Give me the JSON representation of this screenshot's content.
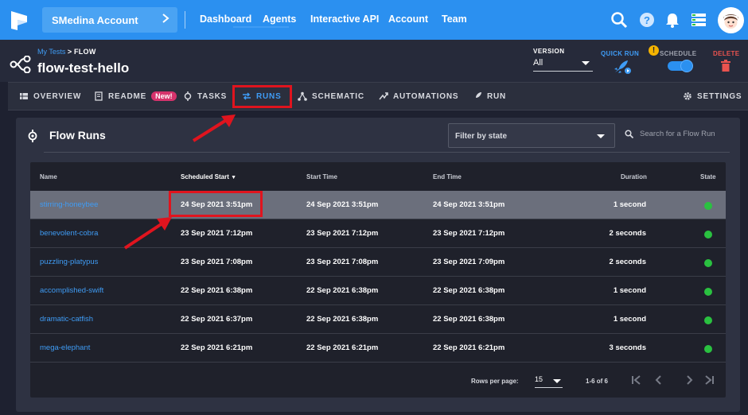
{
  "topbar": {
    "account_label": "SMedina Account",
    "nav": [
      "Dashboard",
      "Agents",
      "Interactive API",
      "Account",
      "Team"
    ]
  },
  "header": {
    "breadcrumb_link": "My Tests",
    "breadcrumb_sep": ">",
    "breadcrumb_current": "FLOW",
    "flow_title": "flow-test-hello",
    "version_label": "VERSION",
    "version_value": "All",
    "quick_run_label": "QUICK RUN",
    "schedule_label": "SCHEDULE",
    "delete_label": "DELETE",
    "warning_glyph": "!"
  },
  "tabs": [
    {
      "label": "OVERVIEW",
      "icon": "grid-icon"
    },
    {
      "label": "README",
      "icon": "document-icon",
      "badge": "New!"
    },
    {
      "label": "TASKS",
      "icon": "task-icon"
    },
    {
      "label": "RUNS",
      "icon": "runs-icon",
      "active": true
    },
    {
      "label": "SCHEMATIC",
      "icon": "schematic-icon"
    },
    {
      "label": "AUTOMATIONS",
      "icon": "automation-icon"
    },
    {
      "label": "RUN",
      "icon": "rocket-icon"
    },
    {
      "label": "SETTINGS",
      "icon": "gear-icon"
    }
  ],
  "panel": {
    "title": "Flow Runs",
    "filter_placeholder": "Filter by state",
    "search_placeholder": "Search for a Flow Run"
  },
  "table": {
    "columns": [
      "Name",
      "Scheduled Start",
      "Start Time",
      "End Time",
      "Duration",
      "State"
    ],
    "sort_indicator": "▼",
    "rows": [
      {
        "name": "stirring-honeybee",
        "scheduled": "24 Sep 2021 3:51pm",
        "start": "24 Sep 2021 3:51pm",
        "end": "24 Sep 2021 3:51pm",
        "duration": "1 second",
        "state": "success"
      },
      {
        "name": "benevolent-cobra",
        "scheduled": "23 Sep 2021 7:12pm",
        "start": "23 Sep 2021 7:12pm",
        "end": "23 Sep 2021 7:12pm",
        "duration": "2 seconds",
        "state": "success"
      },
      {
        "name": "puzzling-platypus",
        "scheduled": "23 Sep 2021 7:08pm",
        "start": "23 Sep 2021 7:08pm",
        "end": "23 Sep 2021 7:09pm",
        "duration": "2 seconds",
        "state": "success"
      },
      {
        "name": "accomplished-swift",
        "scheduled": "22 Sep 2021 6:38pm",
        "start": "22 Sep 2021 6:38pm",
        "end": "22 Sep 2021 6:38pm",
        "duration": "1 second",
        "state": "success"
      },
      {
        "name": "dramatic-catfish",
        "scheduled": "22 Sep 2021 6:37pm",
        "start": "22 Sep 2021 6:38pm",
        "end": "22 Sep 2021 6:38pm",
        "duration": "1 second",
        "state": "success"
      },
      {
        "name": "mega-elephant",
        "scheduled": "22 Sep 2021 6:21pm",
        "start": "22 Sep 2021 6:21pm",
        "end": "22 Sep 2021 6:21pm",
        "duration": "3 seconds",
        "state": "success"
      }
    ],
    "rows_per_page_label": "Rows per page:",
    "rows_per_page_value": "15",
    "range": "1-6 of 6"
  },
  "colors": {
    "topbar": "#2b90f0",
    "accent": "#3f9cf5",
    "success": "#2ac140",
    "highlight": "#e0141e",
    "delete": "#e9534f"
  }
}
